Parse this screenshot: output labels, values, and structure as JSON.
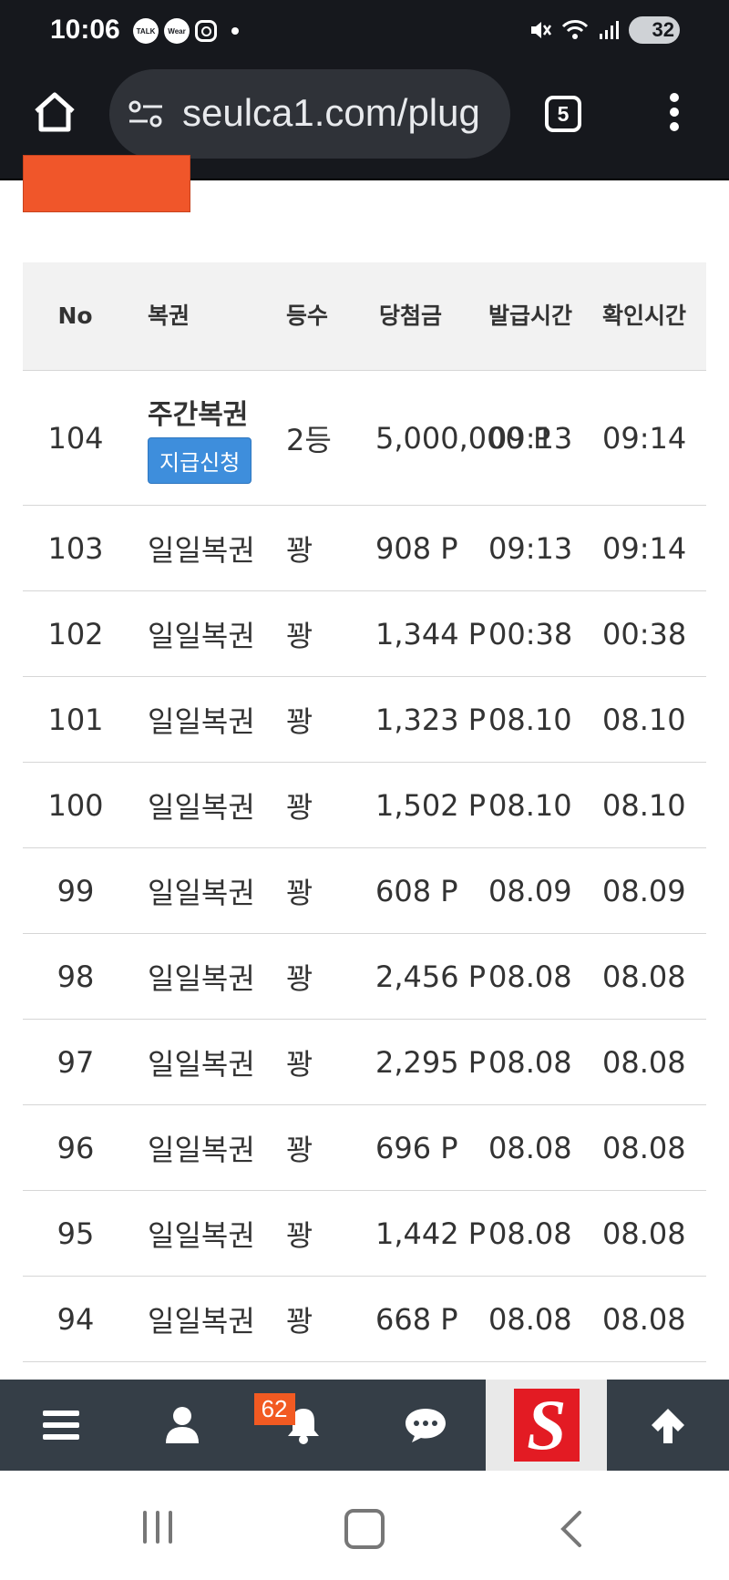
{
  "status_bar": {
    "time": "10:06",
    "notification_icons": [
      "kakaotalk-icon",
      "wear-icon",
      "instagram-icon",
      "dot-icon"
    ],
    "notif_labels": {
      "talk": "TALK",
      "wear": "Wear"
    },
    "battery": "32"
  },
  "browser": {
    "url": "seulca1.com/plug",
    "tab_count": "5"
  },
  "table": {
    "headers": {
      "no": "No",
      "lottery": "복권",
      "rank": "등수",
      "prize": "당첨금",
      "issue_time": "발급시간",
      "check_time": "확인시간"
    },
    "rows": [
      {
        "no": "104",
        "lottery": "주간복권",
        "rank": "2등",
        "prize": "5,000,000 P",
        "issued": "09:13",
        "checked": "09:14",
        "action": "지급신청"
      },
      {
        "no": "103",
        "lottery": "일일복권",
        "rank": "꽝",
        "prize": "908 P",
        "issued": "09:13",
        "checked": "09:14"
      },
      {
        "no": "102",
        "lottery": "일일복권",
        "rank": "꽝",
        "prize": "1,344 P",
        "issued": "00:38",
        "checked": "00:38"
      },
      {
        "no": "101",
        "lottery": "일일복권",
        "rank": "꽝",
        "prize": "1,323 P",
        "issued": "08.10",
        "checked": "08.10"
      },
      {
        "no": "100",
        "lottery": "일일복권",
        "rank": "꽝",
        "prize": "1,502 P",
        "issued": "08.10",
        "checked": "08.10"
      },
      {
        "no": "99",
        "lottery": "일일복권",
        "rank": "꽝",
        "prize": "608 P",
        "issued": "08.09",
        "checked": "08.09"
      },
      {
        "no": "98",
        "lottery": "일일복권",
        "rank": "꽝",
        "prize": "2,456 P",
        "issued": "08.08",
        "checked": "08.08"
      },
      {
        "no": "97",
        "lottery": "일일복권",
        "rank": "꽝",
        "prize": "2,295 P",
        "issued": "08.08",
        "checked": "08.08"
      },
      {
        "no": "96",
        "lottery": "일일복권",
        "rank": "꽝",
        "prize": "696 P",
        "issued": "08.08",
        "checked": "08.08"
      },
      {
        "no": "95",
        "lottery": "일일복권",
        "rank": "꽝",
        "prize": "1,442 P",
        "issued": "08.08",
        "checked": "08.08"
      },
      {
        "no": "94",
        "lottery": "일일복권",
        "rank": "꽝",
        "prize": "668 P",
        "issued": "08.08",
        "checked": "08.08"
      }
    ]
  },
  "bottom_nav": {
    "items": [
      "menu-icon",
      "user-icon",
      "bell-icon",
      "chat-icon",
      "site-logo",
      "arrow-up-icon"
    ],
    "notification_count": "62",
    "logo_letter": "S"
  },
  "colors": {
    "orange": "#f0562a",
    "blue_button": "#3e8edc",
    "nav_bg": "#353e47",
    "logo_red": "#e31b23"
  }
}
